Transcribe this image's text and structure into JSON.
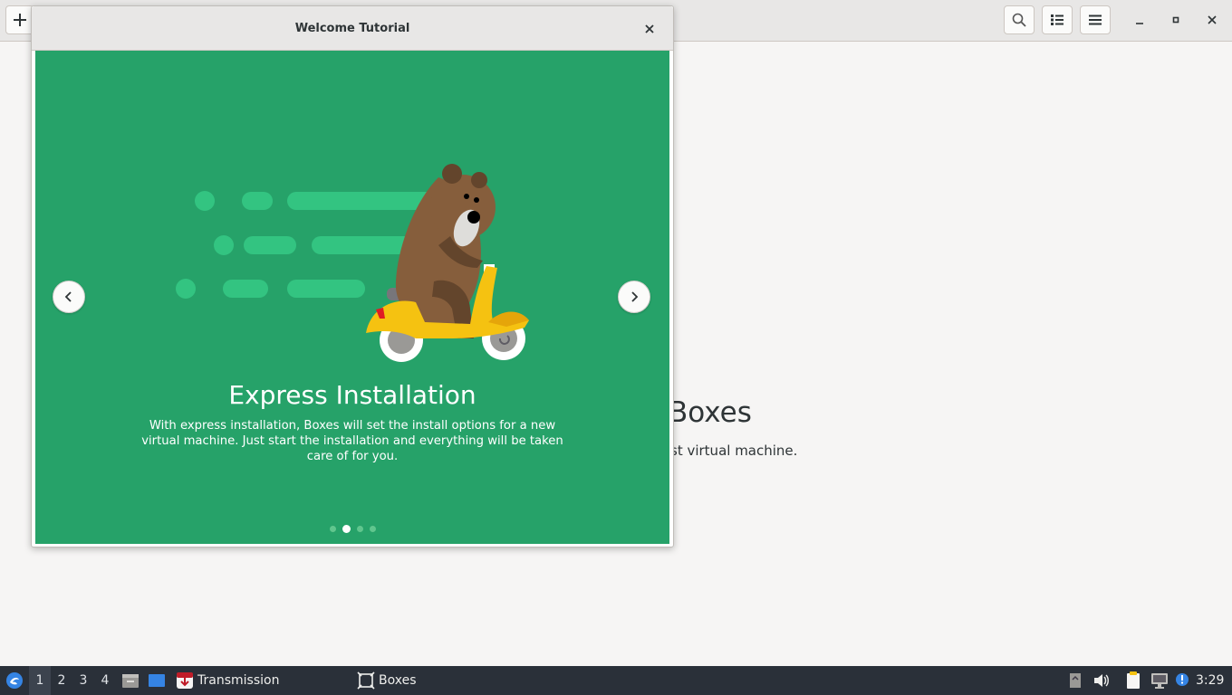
{
  "main_window": {
    "empty_state": {
      "title": "Boxes",
      "subtitle": "st virtual machine."
    }
  },
  "dialog": {
    "title": "Welcome Tutorial",
    "slide": {
      "title": "Express Installation",
      "description": "With express installation, Boxes will set the install options for a new virtual machine. Just start the installation and everything will be taken care of for you.",
      "page_count": 4,
      "current_page": 2
    }
  },
  "taskbar": {
    "workspaces": [
      "1",
      "2",
      "3",
      "4"
    ],
    "active_workspace": "1",
    "apps": [
      {
        "label": "Transmission",
        "icon": "transmission-icon"
      },
      {
        "label": "Boxes",
        "icon": "boxes-icon"
      }
    ],
    "clock": "3:29"
  },
  "colors": {
    "slide_background": "#26a269",
    "taskbar_background": "#2a3039",
    "scooter_yellow": "#f5c211"
  }
}
